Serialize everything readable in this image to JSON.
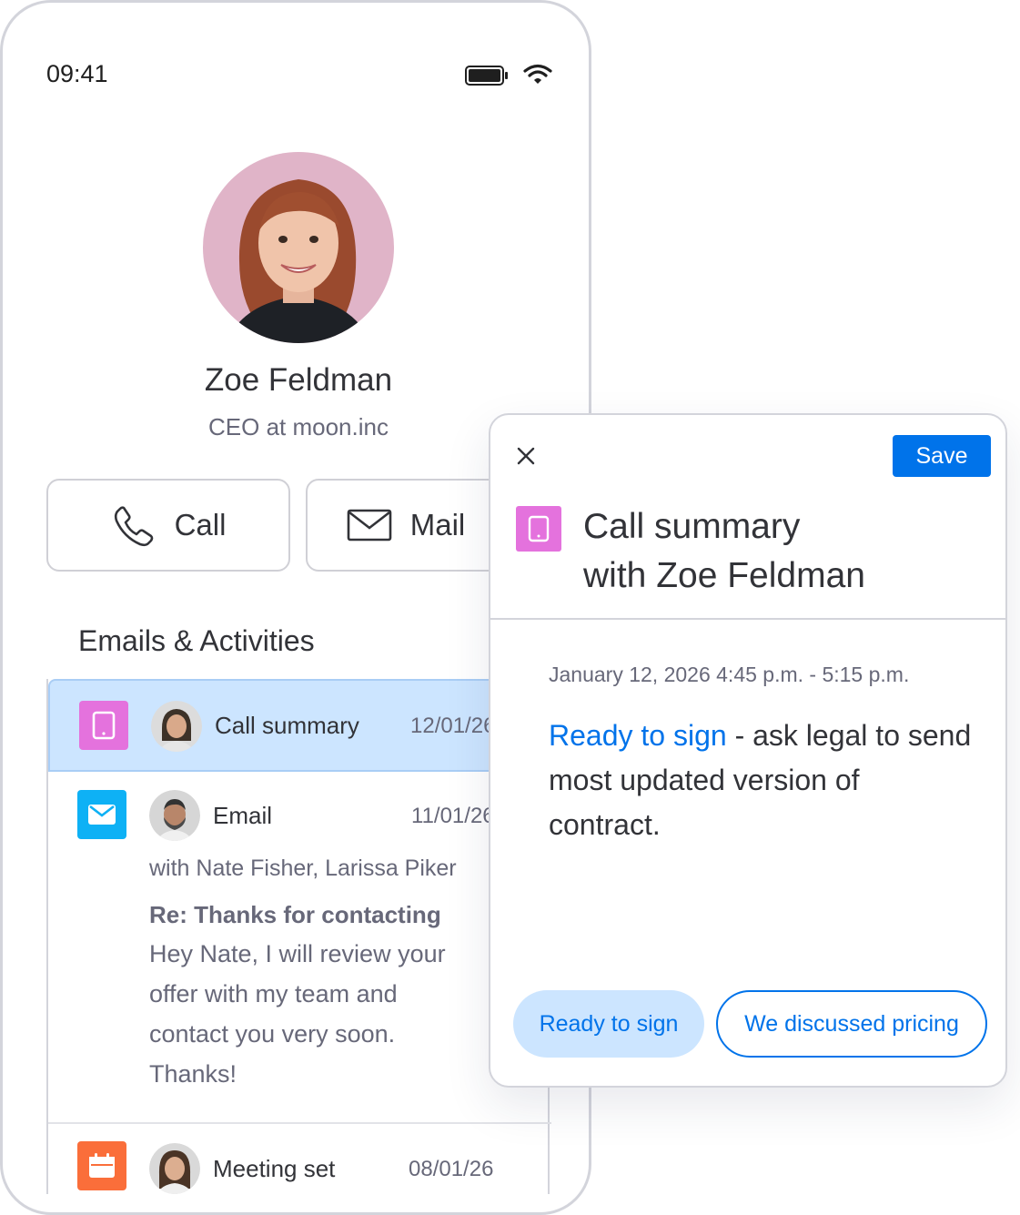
{
  "status_bar": {
    "time": "09:41"
  },
  "contact": {
    "name": "Zoe Feldman",
    "role": "CEO at moon.inc"
  },
  "actions": {
    "call": "Call",
    "mail": "Mail"
  },
  "section_title": "Emails & Activities",
  "activities": {
    "call": {
      "label": "Call summary",
      "date": "12/01/26"
    },
    "email": {
      "label": "Email",
      "date": "11/01/26",
      "participants": "with Nate Fisher, Larissa Piker",
      "subject": "Re: Thanks for contacting",
      "body": [
        "Hey Nate, I will review your",
        "offer with my team and",
        "contact you very soon.",
        "Thanks!"
      ]
    },
    "meeting": {
      "label": "Meeting set",
      "date": "08/01/26"
    }
  },
  "dialog": {
    "save": "Save",
    "title_line1": "Call summary",
    "title_line2": "with Zoe Feldman",
    "date": "January 12, 2026  4:45 p.m. - 5:15 p.m.",
    "note_highlight": "Ready to sign",
    "note_rest": " - ask legal to send most updated version of contract.",
    "chips": [
      "Ready to sign",
      "We discussed pricing"
    ]
  },
  "colors": {
    "accent": "#0073ea",
    "call_icon": "#e472dd",
    "email_icon": "#0eb1f5",
    "meeting_icon": "#fa6e3a",
    "selected_row": "#cce5ff",
    "avatar_bg": "#e0b4c8"
  }
}
